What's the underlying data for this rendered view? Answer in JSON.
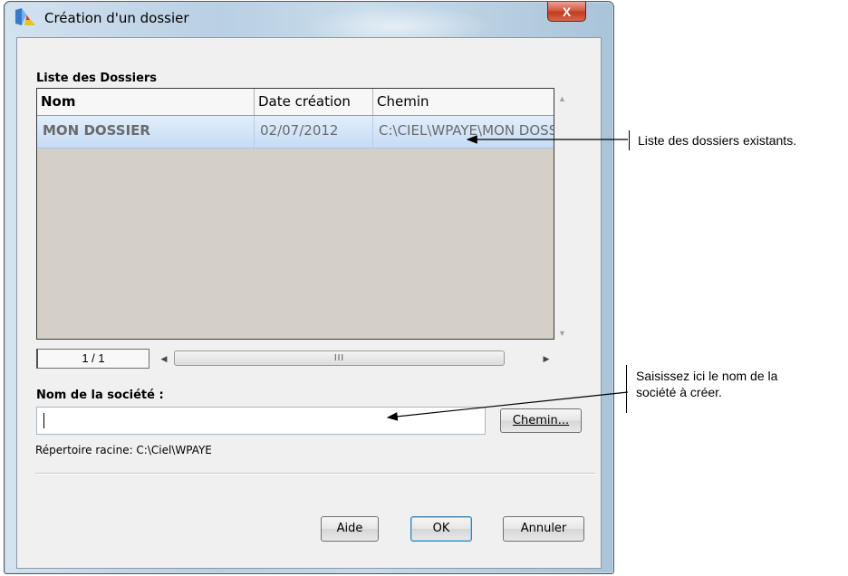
{
  "window": {
    "title": "Création d'un dossier",
    "close_glyph": "X"
  },
  "folders_section": {
    "label": "Liste des Dossiers",
    "columns": [
      "Nom",
      "Date création",
      "Chemin"
    ],
    "rows": [
      {
        "name": "MON DOSSIER",
        "date": "02/07/2012",
        "path": "C:\\CIEL\\WPAYE\\MON DOSSIER"
      }
    ],
    "pager": "1 / 1",
    "hscroll_thumb": "III"
  },
  "company_section": {
    "label": "Nom de la société :",
    "value": "",
    "browse_button": "Chemin...",
    "root_dir": "Répertoire racine: C:\\Ciel\\WPAYE"
  },
  "buttons": {
    "help": "Aide",
    "ok": "OK",
    "cancel": "Annuler"
  },
  "annotations": {
    "list": "Liste des dossiers existants.",
    "name_line1": "Saisissez ici le nom de la",
    "name_line2": "société à créer."
  },
  "colors": {
    "selected_row": "#c6dbf5",
    "list_background": "#d4d0c8",
    "close_button": "#c23a20",
    "default_button_border": "#3c7fb1"
  }
}
